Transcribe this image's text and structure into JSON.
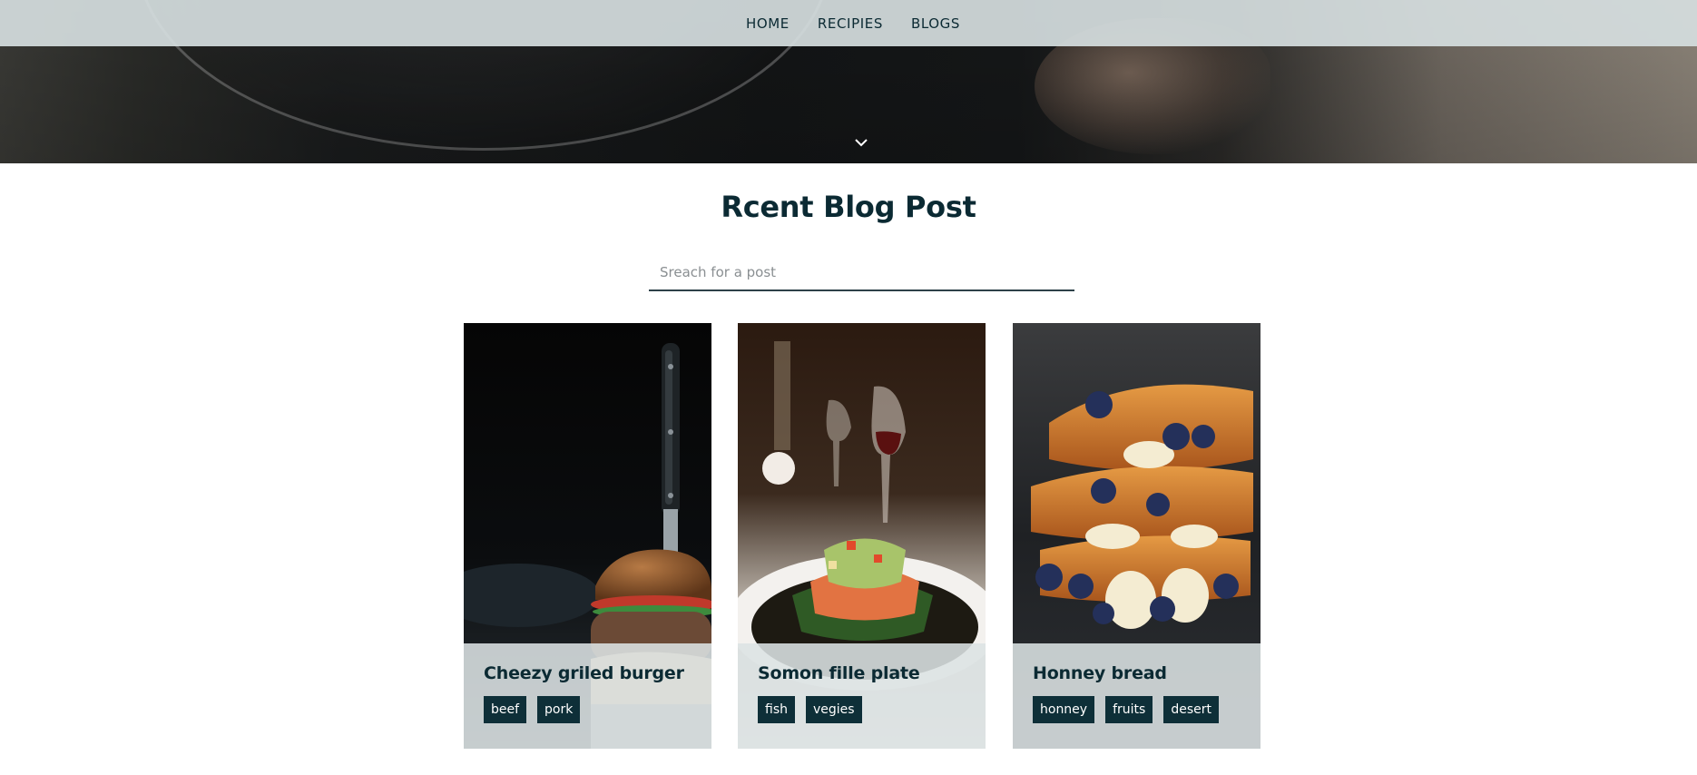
{
  "nav": {
    "links": [
      {
        "label": "HOME"
      },
      {
        "label": "RECIPIES"
      },
      {
        "label": "BLOGS"
      }
    ]
  },
  "hero": {
    "scroll_icon": "chevron-down-icon"
  },
  "main": {
    "title": "Rcent Blog Post",
    "search": {
      "placeholder": "Sreach for a post",
      "value": ""
    }
  },
  "posts": [
    {
      "title": "Cheezy griled burger",
      "tags": [
        "beef",
        "pork"
      ]
    },
    {
      "title": "Somon fille plate",
      "tags": [
        "fish",
        "vegies"
      ]
    },
    {
      "title": "Honney bread",
      "tags": [
        "honney",
        "fruits",
        "desert"
      ]
    }
  ],
  "colors": {
    "accent": "#0e2f38",
    "text": "#0b2a33",
    "navbar_bg": "#d6dee0"
  }
}
